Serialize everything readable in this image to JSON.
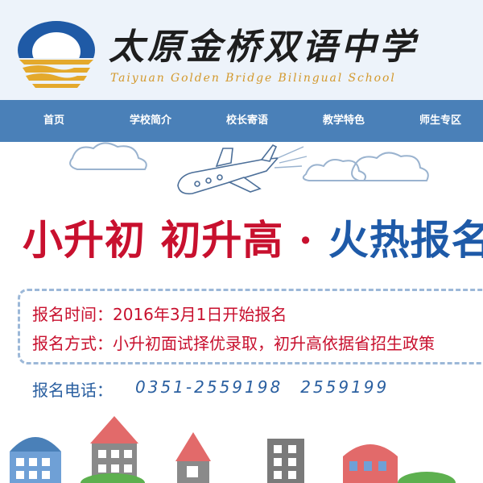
{
  "header": {
    "school_name_cn": "太原金桥双语中学",
    "school_name_en": "Taiyuan Golden Bridge Bilingual School"
  },
  "nav": {
    "items": [
      {
        "label": "首页"
      },
      {
        "label": "学校简介"
      },
      {
        "label": "校长寄语"
      },
      {
        "label": "教学特色"
      },
      {
        "label": "师生专区"
      }
    ]
  },
  "banner": {
    "slogan_part1": "小升初 初升高",
    "slogan_sep": "·",
    "slogan_part2": "火热报名",
    "time_line": "报名时间：2016年3月1日开始报名",
    "method_line": "报名方式：小升初面试择优录取，初升高依据省招生政策",
    "phone_label": "报名电话：",
    "phones": [
      "0351-2559198",
      "2559199"
    ]
  },
  "colors": {
    "nav_bg": "#4a80b8",
    "header_bg": "#edf3fa",
    "slogan_red": "#c8102e",
    "slogan_blue": "#1e5aa8",
    "phone_blue": "#2a5fa0",
    "logo_blue": "#1f5aa6",
    "logo_gold": "#e4a92c"
  }
}
